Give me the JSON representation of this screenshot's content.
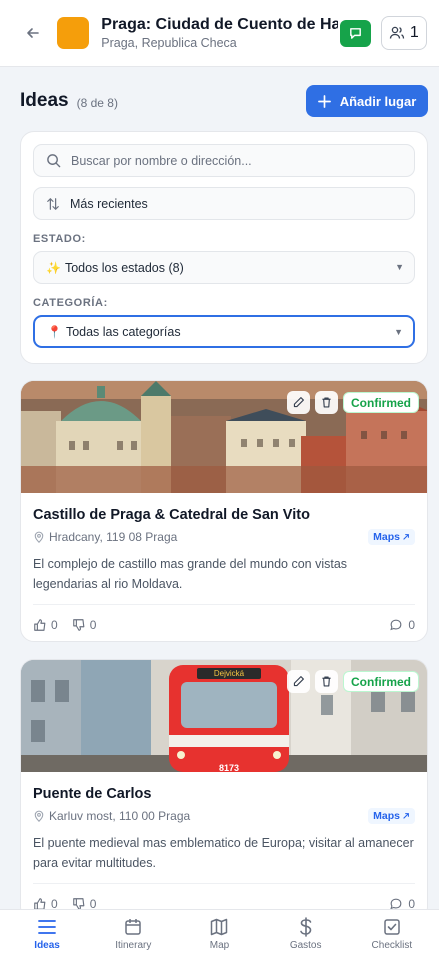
{
  "header": {
    "title": "Praga: Ciudad de Cuento de Hadas",
    "subtitle": "Praga, Republica Checa",
    "member_count": "1",
    "thumb_color": "#f59e0b"
  },
  "section": {
    "title": "Ideas",
    "count": "(8 de 8)",
    "add_label": "Añadir lugar"
  },
  "filters": {
    "search_placeholder": "Buscar por nombre o dirección...",
    "sort_label": "Más recientes",
    "estado_label": "ESTADO:",
    "estado_emoji": "✨",
    "estado_value": "Todos los estados (8)",
    "categoria_label": "CATEGORÍA:",
    "categoria_emoji": "📍",
    "categoria_value": "Todas las categorías"
  },
  "places": [
    {
      "status": "Confirmed",
      "name": "Castillo de Praga & Catedral de San Vito",
      "address": "Hradcany, 119 08 Praga",
      "maps_label": "Maps",
      "description": "El complejo de castillo mas grande del mundo con vistas legendarias al rio Moldava.",
      "likes": "0",
      "dislikes": "0",
      "comments": "0"
    },
    {
      "status": "Confirmed",
      "name": "Puente de Carlos",
      "address": "Karluv most, 110 00 Praga",
      "maps_label": "Maps",
      "description": "El puente medieval mas emblematico de Europa; visitar al amanecer para evitar multitudes.",
      "likes": "0",
      "dislikes": "0",
      "comments": "0",
      "tram_number": "8173",
      "tram_sign": "Dejvická"
    }
  ],
  "nav": {
    "items": [
      {
        "label": "Ideas",
        "icon": "list-icon"
      },
      {
        "label": "Itinerary",
        "icon": "calendar-icon"
      },
      {
        "label": "Map",
        "icon": "map-icon"
      },
      {
        "label": "Gastos",
        "icon": "dollar-icon"
      },
      {
        "label": "Checklist",
        "icon": "checklist-icon"
      }
    ],
    "active": "Ideas"
  },
  "colors": {
    "primary": "#2f6fe4",
    "success": "#16a34a",
    "active_nav": "#2563eb"
  }
}
